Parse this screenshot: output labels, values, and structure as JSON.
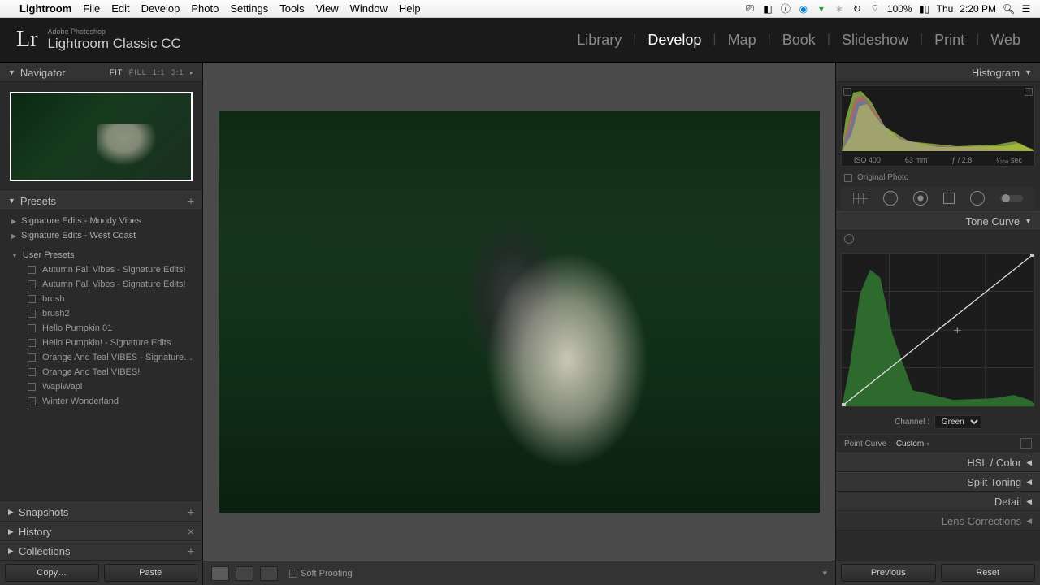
{
  "menubar": {
    "app": "Lightroom",
    "items": [
      "File",
      "Edit",
      "Develop",
      "Photo",
      "Settings",
      "Tools",
      "View",
      "Window",
      "Help"
    ],
    "battery": "100%",
    "day": "Thu",
    "time": "2:20 PM"
  },
  "lr": {
    "brand_small": "Adobe Photoshop",
    "brand": "Lightroom Classic CC"
  },
  "modules": [
    "Library",
    "Develop",
    "Map",
    "Book",
    "Slideshow",
    "Print",
    "Web"
  ],
  "module_active": 1,
  "left": {
    "navigator": {
      "title": "Navigator",
      "opts": [
        "FIT",
        "FILL",
        "1:1",
        "3:1"
      ]
    },
    "presets_title": "Presets",
    "groups": [
      {
        "name": "Signature Edits - Moody Vibes",
        "open": false
      },
      {
        "name": "Signature Edits - West Coast",
        "open": false
      },
      {
        "name": "User Presets",
        "open": true,
        "items": [
          "Autumn Fall Vibes - Signature Edits!",
          "Autumn Fall Vibes - Signature Edits!",
          "brush",
          "brush2",
          "Hello Pumpkin 01",
          "Hello Pumpkin! - Signature Edits",
          "Orange And Teal VIBES - Signature…",
          "Orange And Teal VIBES!",
          "WapiWapi",
          "Winter Wonderland"
        ]
      }
    ],
    "snapshots": "Snapshots",
    "history": "History",
    "collections": "Collections",
    "copy": "Copy…",
    "paste": "Paste"
  },
  "center": {
    "softproof": "Soft Proofing"
  },
  "right": {
    "histogram": "Histogram",
    "iso": "ISO 400",
    "focal": "63 mm",
    "ap": "ƒ / 2.8",
    "shutter": "¹⁄₂₀₀ sec",
    "orig": "Original Photo",
    "tonecurve": "Tone Curve",
    "channel_label": "Channel :",
    "channel": "Green",
    "pointcurve_label": "Point Curve :",
    "pointcurve": "Custom",
    "panel_hsl": "HSL / Color",
    "panel_split": "Split Toning",
    "panel_detail": "Detail",
    "panel_lens": "Lens Corrections",
    "previous": "Previous",
    "reset": "Reset"
  }
}
